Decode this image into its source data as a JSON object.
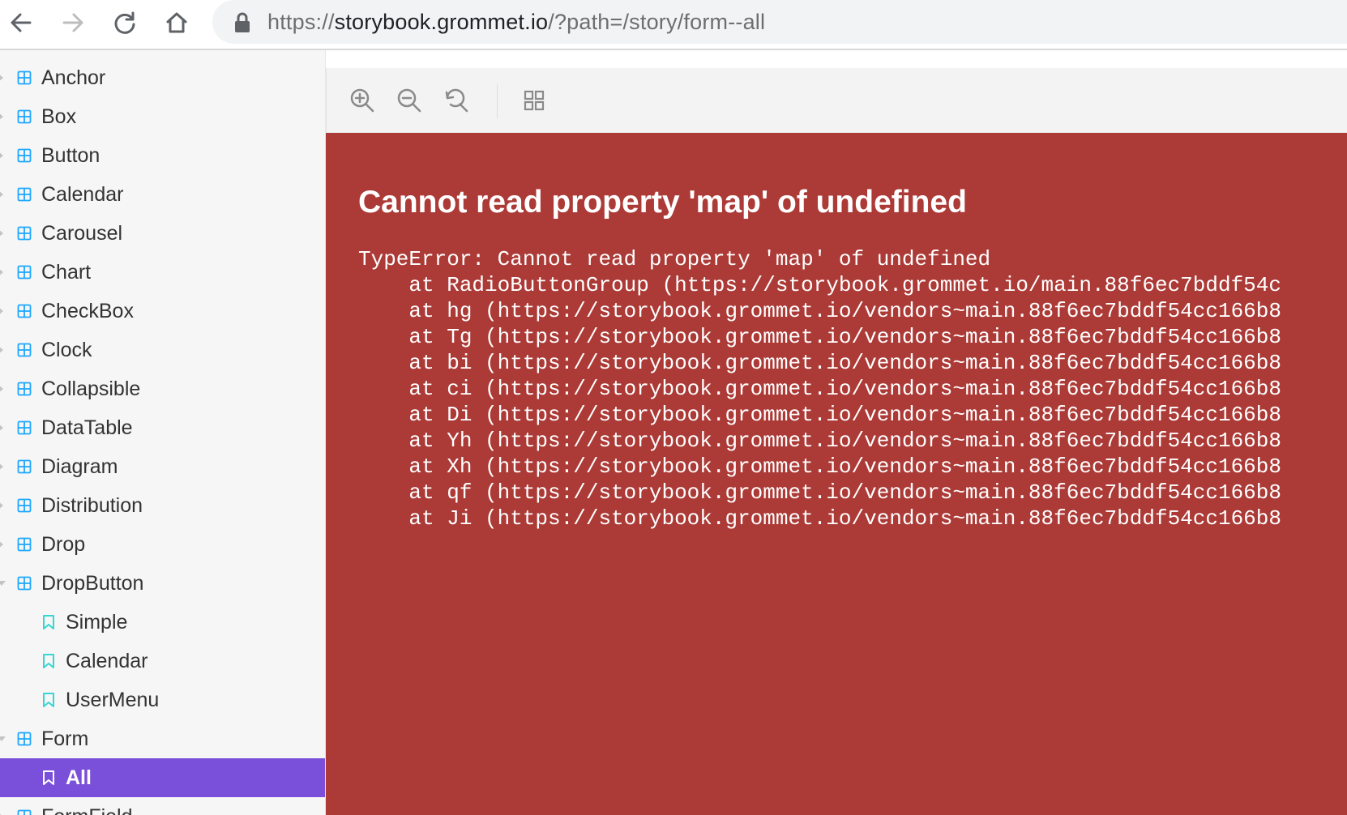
{
  "browser": {
    "url_scheme": "https://",
    "url_host": "storybook.grommet.io",
    "url_path": "/?path=/story/form--all"
  },
  "sidebar": {
    "items": [
      {
        "label": "Anchor",
        "kind": "component",
        "expanded": false
      },
      {
        "label": "Box",
        "kind": "component",
        "expanded": false
      },
      {
        "label": "Button",
        "kind": "component",
        "expanded": false
      },
      {
        "label": "Calendar",
        "kind": "component",
        "expanded": false
      },
      {
        "label": "Carousel",
        "kind": "component",
        "expanded": false
      },
      {
        "label": "Chart",
        "kind": "component",
        "expanded": false
      },
      {
        "label": "CheckBox",
        "kind": "component",
        "expanded": false
      },
      {
        "label": "Clock",
        "kind": "component",
        "expanded": false
      },
      {
        "label": "Collapsible",
        "kind": "component",
        "expanded": false
      },
      {
        "label": "DataTable",
        "kind": "component",
        "expanded": false
      },
      {
        "label": "Diagram",
        "kind": "component",
        "expanded": false
      },
      {
        "label": "Distribution",
        "kind": "component",
        "expanded": false
      },
      {
        "label": "Drop",
        "kind": "component",
        "expanded": false
      },
      {
        "label": "DropButton",
        "kind": "component",
        "expanded": true
      },
      {
        "label": "Simple",
        "kind": "story"
      },
      {
        "label": "Calendar",
        "kind": "story"
      },
      {
        "label": "UserMenu",
        "kind": "story"
      },
      {
        "label": "Form",
        "kind": "component",
        "expanded": true
      },
      {
        "label": "All",
        "kind": "story",
        "selected": true
      },
      {
        "label": "FormField",
        "kind": "component",
        "expanded": false
      }
    ]
  },
  "toolbar": {
    "icons": [
      "zoom-in-icon",
      "zoom-out-icon",
      "reset-zoom-icon",
      "grid-icon"
    ]
  },
  "error": {
    "title": "Cannot read property 'map' of undefined",
    "stack": [
      "TypeError: Cannot read property 'map' of undefined",
      "    at RadioButtonGroup (https://storybook.grommet.io/main.88f6ec7bddf54c",
      "    at hg (https://storybook.grommet.io/vendors~main.88f6ec7bddf54cc166b8",
      "    at Tg (https://storybook.grommet.io/vendors~main.88f6ec7bddf54cc166b8",
      "    at bi (https://storybook.grommet.io/vendors~main.88f6ec7bddf54cc166b8",
      "    at ci (https://storybook.grommet.io/vendors~main.88f6ec7bddf54cc166b8",
      "    at Di (https://storybook.grommet.io/vendors~main.88f6ec7bddf54cc166b8",
      "    at Yh (https://storybook.grommet.io/vendors~main.88f6ec7bddf54cc166b8",
      "    at Xh (https://storybook.grommet.io/vendors~main.88f6ec7bddf54cc166b8",
      "    at qf (https://storybook.grommet.io/vendors~main.88f6ec7bddf54cc166b8",
      "    at Ji (https://storybook.grommet.io/vendors~main.88f6ec7bddf54cc166b8"
    ]
  },
  "colors": {
    "selected": "#7a4fd9",
    "error_bg": "#ac3a36",
    "component_icon": "#1ea7fd",
    "story_icon": "#37d5d3"
  }
}
